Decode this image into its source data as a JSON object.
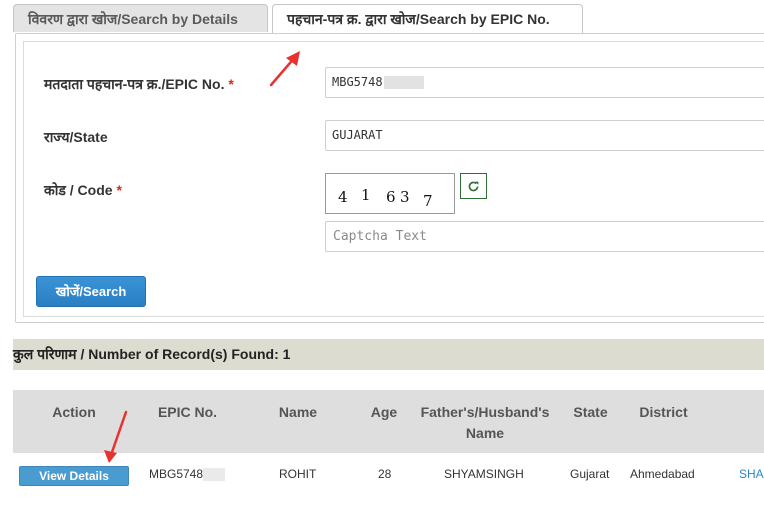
{
  "tabs": {
    "details": "विवरण द्वारा खोज/Search by Details",
    "epic": "पहचान-पत्र क्र. द्वारा खोज/Search by EPIC No."
  },
  "form": {
    "epic_label": "मतदाता पहचान-पत्र क्र./EPIC No.",
    "required_mark": "*",
    "epic_value": "MBG5748",
    "state_label": "राज्य/State",
    "state_value": "GUJARAT",
    "code_label": "कोड / Code",
    "captcha_digits": [
      "4",
      "1",
      "6",
      "3",
      "7"
    ],
    "captcha_placeholder": "Captcha Text",
    "search_label": "खोजें/Search"
  },
  "records": {
    "found_text": "कुल परिणाम / Number of Record(s) Found: 1"
  },
  "table": {
    "headers": {
      "action": "Action",
      "epic": "EPIC No.",
      "name": "Name",
      "age": "Age",
      "relative": "Father's/Husband's Name",
      "state": "State",
      "district": "District"
    },
    "row": {
      "action_label": "View Details",
      "epic": "MBG5748",
      "name": "ROHIT",
      "age": "28",
      "relative": "SHYAMSINGH",
      "state": "Gujarat",
      "district": "Ahmedabad",
      "extra": "SHA"
    }
  },
  "colors": {
    "accent": "#2a7fc2",
    "required": "#d9261c",
    "annotation_arrow": "#e8322f"
  },
  "icons": {
    "refresh": "refresh-icon",
    "annotation": "arrow-icon"
  }
}
